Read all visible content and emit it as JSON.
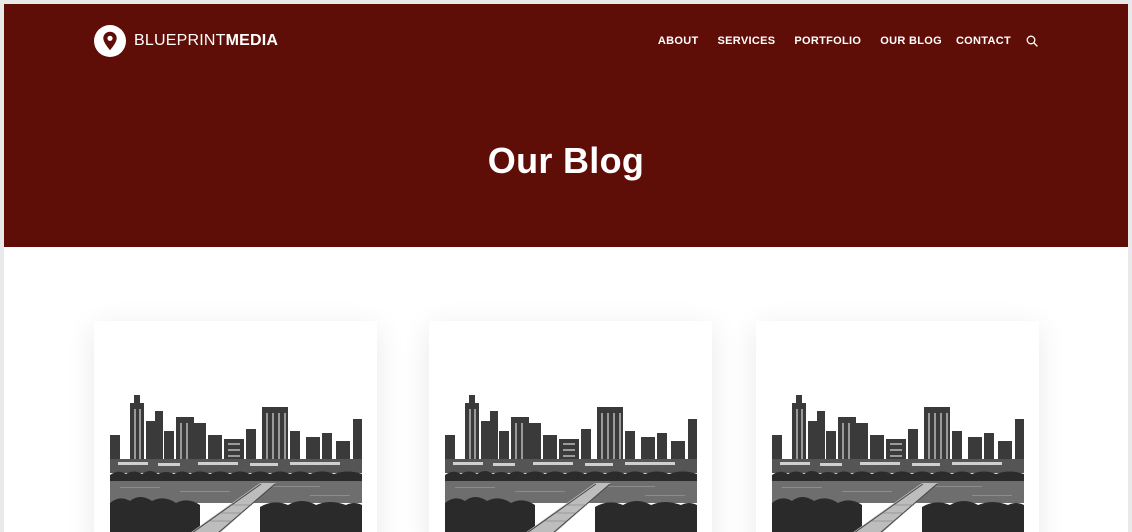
{
  "header": {
    "logo": {
      "name_light": "BLUEPRINT",
      "name_bold": "MEDIA",
      "icon": "map-pin-icon"
    },
    "nav": [
      {
        "label": "ABOUT"
      },
      {
        "label": "SERVICES"
      },
      {
        "label": "PORTFOLIO"
      },
      {
        "label": "OUR BLOG"
      },
      {
        "label": "CONTACT"
      }
    ],
    "search_icon": "search-icon"
  },
  "hero": {
    "title": "Our Blog",
    "background": "#5e0e07"
  },
  "posts": [
    {
      "image": "city-skyline-bw"
    },
    {
      "image": "city-skyline-bw"
    },
    {
      "image": "city-skyline-bw"
    }
  ],
  "colors": {
    "brand": "#5e0e07",
    "text_on_brand": "#ffffff",
    "page_bg": "#ffffff"
  }
}
